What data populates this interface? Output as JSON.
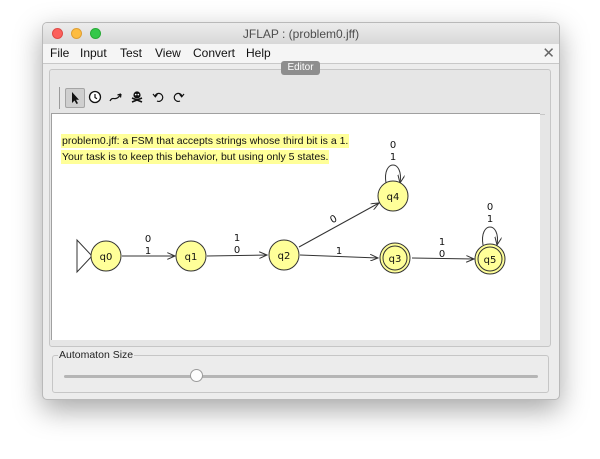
{
  "window": {
    "title": "JFLAP : (problem0.jff)"
  },
  "menu": {
    "items": [
      "File",
      "Input",
      "Test",
      "View",
      "Convert",
      "Help"
    ],
    "close_glyph": "✕"
  },
  "editor_tab": {
    "label": "Editor"
  },
  "toolbar": {
    "tools": [
      {
        "name": "attribute-editor",
        "icon": "arrow-pointer-icon",
        "selected": true
      },
      {
        "name": "state-creator",
        "icon": "state-create-icon",
        "selected": false
      },
      {
        "name": "transition-creator",
        "icon": "transition-arrow-icon",
        "selected": false
      },
      {
        "name": "deleter",
        "icon": "skull-icon",
        "selected": false
      },
      {
        "name": "undo",
        "icon": "undo-icon",
        "selected": false
      },
      {
        "name": "redo",
        "icon": "redo-icon",
        "selected": false
      }
    ]
  },
  "notes": [
    "problem0.jff: a FSM that accepts strings whose third bit is a 1.",
    "Your task is to keep this behavior, but using only 5 states."
  ],
  "automaton": {
    "initial_state": "q0",
    "states": [
      {
        "id": "q0",
        "final": false
      },
      {
        "id": "q1",
        "final": false
      },
      {
        "id": "q2",
        "final": false
      },
      {
        "id": "q3",
        "final": true
      },
      {
        "id": "q4",
        "final": false
      },
      {
        "id": "q5",
        "final": true
      }
    ],
    "transitions": [
      {
        "from": "q0",
        "to": "q1",
        "labels": [
          "0",
          "1"
        ]
      },
      {
        "from": "q1",
        "to": "q2",
        "labels": [
          "1",
          "0"
        ]
      },
      {
        "from": "q2",
        "to": "q4",
        "labels": [
          "0"
        ]
      },
      {
        "from": "q2",
        "to": "q3",
        "labels": [
          "1"
        ]
      },
      {
        "from": "q3",
        "to": "q5",
        "labels": [
          "1",
          "0"
        ]
      },
      {
        "from": "q4",
        "to": "q4",
        "labels": [
          "0",
          "1"
        ]
      },
      {
        "from": "q5",
        "to": "q5",
        "labels": [
          "0",
          "1"
        ]
      }
    ],
    "colors": {
      "state_fill": "#ffff99",
      "state_stroke": "#333333",
      "note_bg": "#ffff99"
    }
  },
  "automaton_size": {
    "label": "Automaton Size",
    "slider_fraction": 0.28
  }
}
